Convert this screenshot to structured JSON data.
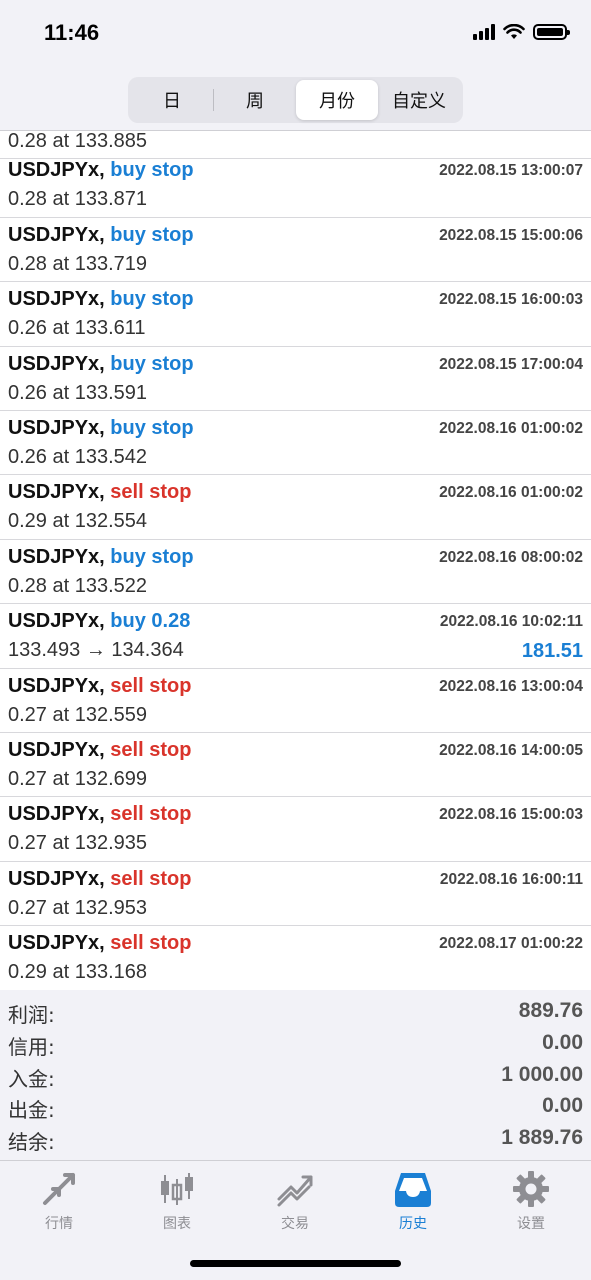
{
  "status_bar": {
    "time": "11:46"
  },
  "segments": [
    {
      "label": "日",
      "active": false
    },
    {
      "label": "周",
      "active": false
    },
    {
      "label": "月份",
      "active": true
    },
    {
      "label": "自定义",
      "active": false
    }
  ],
  "partial_row": {
    "sub": "0.28 at 133.885"
  },
  "orders": [
    {
      "symbol": "USDJPYx,",
      "type": "buy stop",
      "side": "buy",
      "sub": "0.28 at 133.871",
      "time": "2022.08.15 13:00:07"
    },
    {
      "symbol": "USDJPYx,",
      "type": "buy stop",
      "side": "buy",
      "sub": "0.28 at 133.719",
      "time": "2022.08.15 15:00:06"
    },
    {
      "symbol": "USDJPYx,",
      "type": "buy stop",
      "side": "buy",
      "sub": "0.26 at 133.611",
      "time": "2022.08.15 16:00:03"
    },
    {
      "symbol": "USDJPYx,",
      "type": "buy stop",
      "side": "buy",
      "sub": "0.26 at 133.591",
      "time": "2022.08.15 17:00:04"
    },
    {
      "symbol": "USDJPYx,",
      "type": "buy stop",
      "side": "buy",
      "sub": "0.26 at 133.542",
      "time": "2022.08.16 01:00:02"
    },
    {
      "symbol": "USDJPYx,",
      "type": "sell stop",
      "side": "sell",
      "sub": "0.29 at 132.554",
      "time": "2022.08.16 01:00:02"
    },
    {
      "symbol": "USDJPYx,",
      "type": "buy stop",
      "side": "buy",
      "sub": "0.28 at 133.522",
      "time": "2022.08.16 08:00:02"
    },
    {
      "symbol": "USDJPYx,",
      "type": "buy 0.28",
      "side": "buy",
      "sub": "133.493 → 134.364",
      "time": "2022.08.16 10:02:11",
      "profit": "181.51"
    },
    {
      "symbol": "USDJPYx,",
      "type": "sell stop",
      "side": "sell",
      "sub": "0.27 at 132.559",
      "time": "2022.08.16 13:00:04"
    },
    {
      "symbol": "USDJPYx,",
      "type": "sell stop",
      "side": "sell",
      "sub": "0.27 at 132.699",
      "time": "2022.08.16 14:00:05"
    },
    {
      "symbol": "USDJPYx,",
      "type": "sell stop",
      "side": "sell",
      "sub": "0.27 at 132.935",
      "time": "2022.08.16 15:00:03"
    },
    {
      "symbol": "USDJPYx,",
      "type": "sell stop",
      "side": "sell",
      "sub": "0.27 at 132.953",
      "time": "2022.08.16 16:00:11"
    },
    {
      "symbol": "USDJPYx,",
      "type": "sell stop",
      "side": "sell",
      "sub": "0.29 at 133.168",
      "time": "2022.08.17 01:00:22"
    }
  ],
  "summary": [
    {
      "label": "利润:",
      "value": "889.76"
    },
    {
      "label": "信用:",
      "value": "0.00"
    },
    {
      "label": "入金:",
      "value": "1 000.00"
    },
    {
      "label": "出金:",
      "value": "0.00"
    },
    {
      "label": "结余:",
      "value": "1 889.76"
    }
  ],
  "tabs": [
    {
      "label": "行情",
      "icon": "quotes-icon",
      "active": false
    },
    {
      "label": "图表",
      "icon": "chart-icon",
      "active": false
    },
    {
      "label": "交易",
      "icon": "trade-icon",
      "active": false
    },
    {
      "label": "历史",
      "icon": "history-icon",
      "active": true
    },
    {
      "label": "设置",
      "icon": "gear-icon",
      "active": false
    }
  ],
  "colors": {
    "buy": "#1a7fd4",
    "sell": "#d9342b",
    "tab_active": "#1a7fd4",
    "tab_inactive": "#8e8e93"
  }
}
